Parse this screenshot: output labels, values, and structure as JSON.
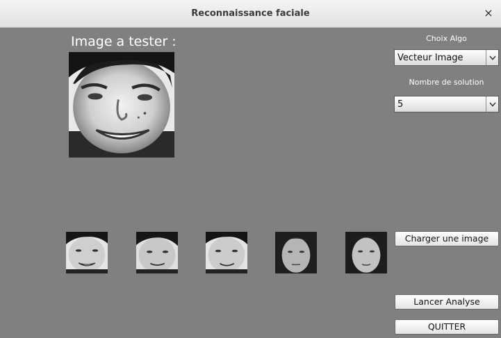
{
  "window": {
    "title": "Reconnaissance faciale",
    "close_glyph": "×"
  },
  "test_panel": {
    "label": "Image a tester :"
  },
  "controls": {
    "algo_label": "Choix Algo",
    "algo_selected": "Vecteur Image",
    "solution_label": "Nombre de solution",
    "solution_selected": "5",
    "load_button": "Charger une image",
    "analyze_button": "Lancer Analyse",
    "quit_button": "QUITTER"
  },
  "results": {
    "count": 5
  },
  "icons": {
    "close": "close-icon",
    "dropdown": "chevron-down-icon"
  },
  "colors": {
    "background": "#808080",
    "titlebar": "#e9e9e9",
    "label_text": "#ffffff"
  }
}
